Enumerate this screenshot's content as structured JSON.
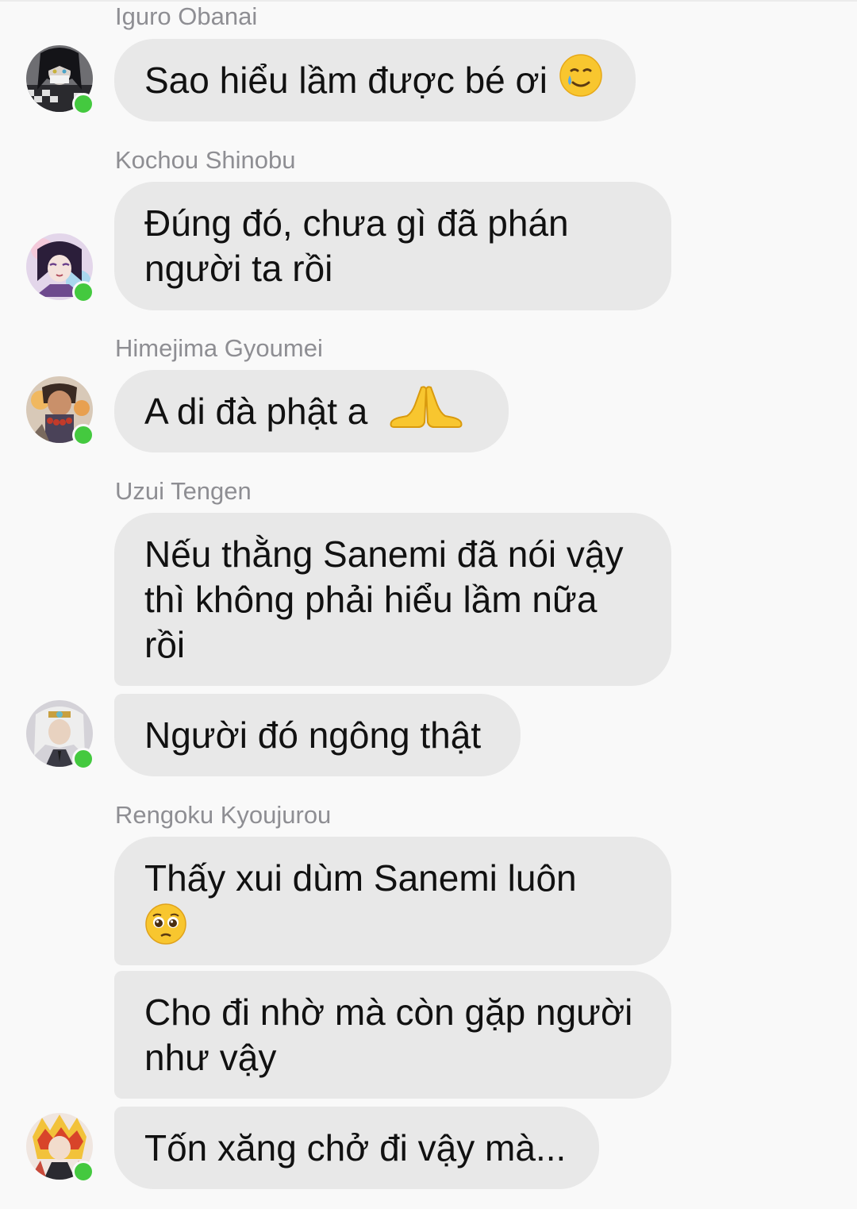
{
  "messages": [
    {
      "sender": "Iguro Obanai",
      "bubbles": [
        "Sao hiểu lầm được bé ơi"
      ],
      "emoji": "crying-smile-emoji"
    },
    {
      "sender": "Kochou Shinobu",
      "bubbles": [
        "Đúng đó, chưa gì đã phán người ta rồi"
      ]
    },
    {
      "sender": "Himejima Gyoumei",
      "bubbles": [
        "A di đà phật a"
      ],
      "emoji": "folded-hands-emoji"
    },
    {
      "sender": "Uzui Tengen",
      "bubbles": [
        "Nếu thằng Sanemi đã nói vậy thì không phải hiểu lầm nữa rồi",
        "Người đó ngông thật"
      ]
    },
    {
      "sender": "Rengoku Kyoujurou",
      "bubbles": [
        "Thấy xui dùm Sanemi luôn",
        "Cho đi nhờ mà còn gặp người như vậy",
        "Tốn xăng chở đi vậy mà..."
      ],
      "emoji": "pleading-face-emoji"
    }
  ],
  "colors": {
    "bubble": "#e8e8e8",
    "sender": "#8e8e93",
    "online": "#44c93f",
    "background": "#f9f9f9"
  }
}
